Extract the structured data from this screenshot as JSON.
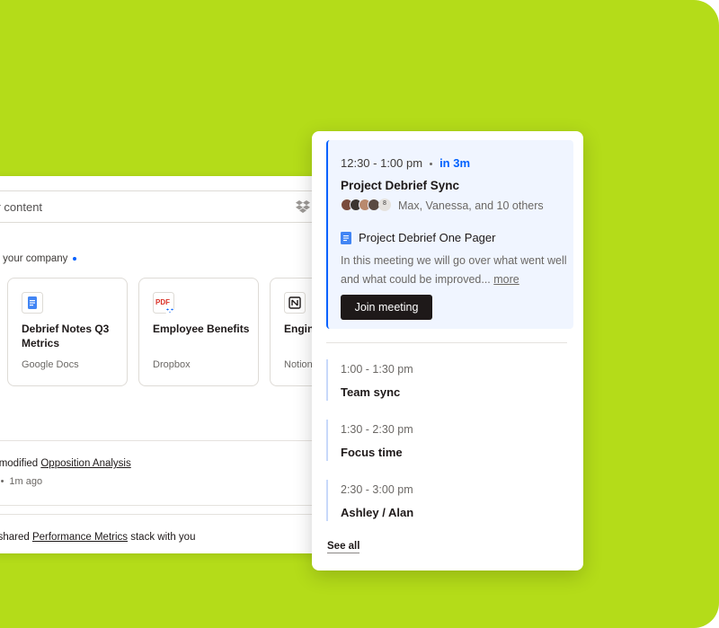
{
  "colors": {
    "background": "#b4dc19",
    "accent": "#0061fe",
    "button": "#1e1919",
    "event_highlight": "#f0f5ff"
  },
  "search": {
    "placeholder": "our content",
    "icon": "dropbox-icon"
  },
  "content": {
    "section_label": "om your company",
    "cards": [
      {
        "title": "Debrief Notes Q3 Metrics",
        "source": "Google Docs",
        "icon": "google-docs-icon"
      },
      {
        "title": "Employee Benefits",
        "source": "Dropbox",
        "icon": "pdf-icon",
        "icon_label": "PDF"
      },
      {
        "title": "Engin Projec",
        "source": "Notion",
        "icon": "notion-icon"
      }
    ]
  },
  "activity": [
    {
      "prefix": "ck modified ",
      "link": "Opposition Analysis",
      "suffix": "",
      "meta_source": "ts",
      "meta_time": "1m ago"
    },
    {
      "prefix": "n shared ",
      "link": "Performance Metrics",
      "suffix": " stack with you"
    }
  ],
  "calendar": {
    "active_event": {
      "time": "12:30 - 1:00 pm",
      "countdown": "in 3m",
      "title": "Project Debrief Sync",
      "avatar_count": "8",
      "attendees": "Max, Vanessa, and 10 others",
      "doc_title": "Project Debrief One Pager",
      "description": "In this meeting we will go over what went well and what could be improved...",
      "more_label": "more",
      "join_label": "Join meeting"
    },
    "events": [
      {
        "time": "1:00 - 1:30 pm",
        "title": "Team sync"
      },
      {
        "time": "1:30 - 2:30 pm",
        "title": "Focus time"
      },
      {
        "time": "2:30 - 3:00 pm",
        "title": "Ashley / Alan"
      }
    ],
    "see_all_label": "See all"
  }
}
